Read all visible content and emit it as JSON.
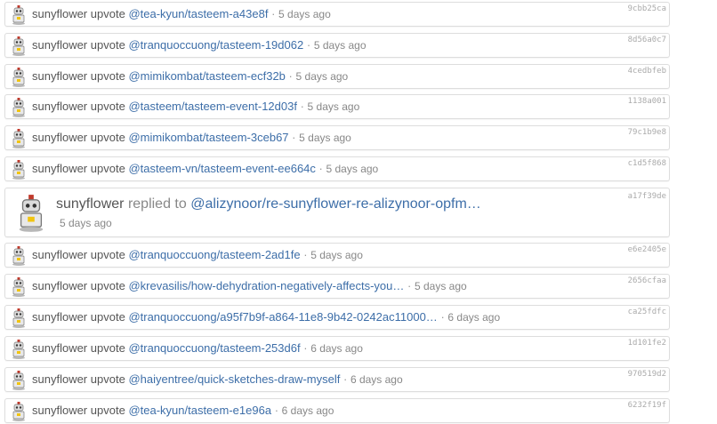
{
  "rows": [
    {
      "user": "sunyflower",
      "action": "upvote",
      "target": "@tea-kyun/tasteem-a43e8f",
      "time": "5 days ago",
      "hash": "9cbb25ca"
    },
    {
      "user": "sunyflower",
      "action": "upvote",
      "target": "@tranquoccuong/tasteem-19d062",
      "time": "5 days ago",
      "hash": "8d56a0c7"
    },
    {
      "user": "sunyflower",
      "action": "upvote",
      "target": "@mimikombat/tasteem-ecf32b",
      "time": "5 days ago",
      "hash": "4cedbfeb"
    },
    {
      "user": "sunyflower",
      "action": "upvote",
      "target": "@tasteem/tasteem-event-12d03f",
      "time": "5 days ago",
      "hash": "1138a001"
    },
    {
      "user": "sunyflower",
      "action": "upvote",
      "target": "@mimikombat/tasteem-3ceb67",
      "time": "5 days ago",
      "hash": "79c1b9e8"
    },
    {
      "user": "sunyflower",
      "action": "upvote",
      "target": "@tasteem-vn/tasteem-event-ee664c",
      "time": "5 days ago",
      "hash": "c1d5f868"
    },
    {
      "user": "sunyflower",
      "action": "replied to",
      "target": "@alizynoor/re-sunyflower-re-alizynoor-opfm…",
      "time": "5 days ago",
      "hash": "a17f39de"
    },
    {
      "user": "sunyflower",
      "action": "upvote",
      "target": "@tranquoccuong/tasteem-2ad1fe",
      "time": "5 days ago",
      "hash": "e6e2405e"
    },
    {
      "user": "sunyflower",
      "action": "upvote",
      "target": "@krevasilis/how-dehydration-negatively-affects-you…",
      "time": "5 days ago",
      "hash": "2656cfaa"
    },
    {
      "user": "sunyflower",
      "action": "upvote",
      "target": "@tranquoccuong/a95f7b9f-a864-11e8-9b42-0242ac11000…",
      "time": "6 days ago",
      "hash": "ca25fdfc"
    },
    {
      "user": "sunyflower",
      "action": "upvote",
      "target": "@tranquoccuong/tasteem-253d6f",
      "time": "6 days ago",
      "hash": "1d101fe2"
    },
    {
      "user": "sunyflower",
      "action": "upvote",
      "target": "@haiyentree/quick-sketches-draw-myself",
      "time": "6 days ago",
      "hash": "970519d2"
    },
    {
      "user": "sunyflower",
      "action": "upvote",
      "target": "@tea-kyun/tasteem-e1e96a",
      "time": "6 days ago",
      "hash": "6232f19f"
    }
  ],
  "separator": "·",
  "colors": {
    "link": "#3d6ea8",
    "text": "#555555",
    "muted": "#888888",
    "border": "#dddddd"
  },
  "icons": {
    "avatar": "robot-avatar-icon"
  }
}
